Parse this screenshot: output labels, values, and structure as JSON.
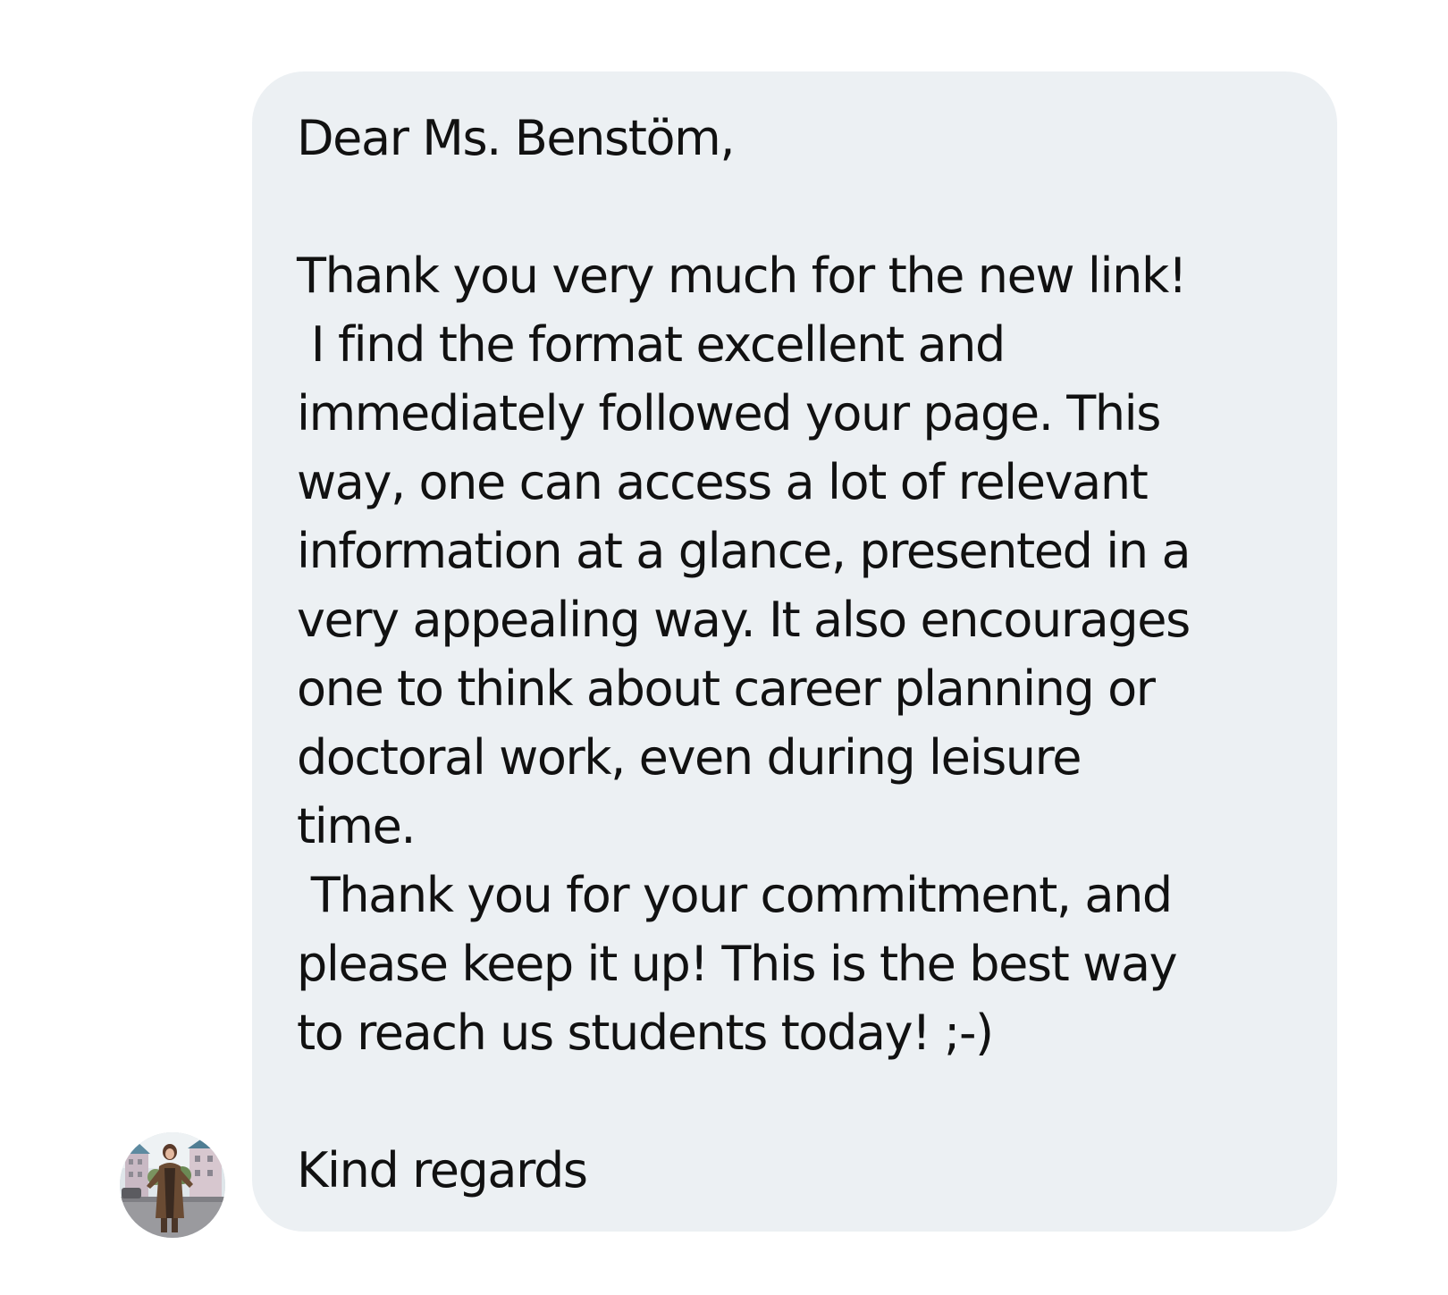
{
  "conversation": {
    "message": {
      "lines": [
        "Dear Ms. Benstöm,",
        "",
        "Thank you very much for the new link!",
        " I find the format excellent and",
        "immediately followed your page. This",
        "way, one can access a lot of relevant",
        "information at a glance, presented in a",
        "very appealing way. It also encourages",
        "one to think about career planning or",
        "doctoral work, even during leisure",
        "time.",
        " Thank you for your commitment, and",
        "please keep it up! This is the best way",
        "to reach us students today! ;-)",
        "",
        "Kind regards"
      ],
      "bubble_color": "#ecf0f3",
      "text_color": "#111111"
    },
    "sender": {
      "avatar_icon": "profile-photo-icon"
    }
  }
}
